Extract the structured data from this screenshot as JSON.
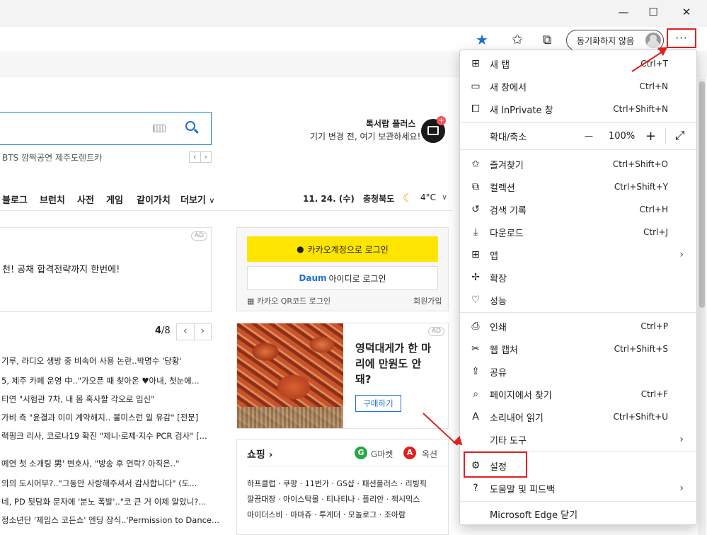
{
  "window": {
    "minimize_glyph": "—",
    "maximize_glyph": "☐",
    "close_glyph": "✕"
  },
  "toolbar": {
    "favorite_star_glyph": "★",
    "favorites_glyph": "✩",
    "collections_glyph": "⧉",
    "sync_label": "동기화하지 않음",
    "more_glyph": "···"
  },
  "page": {
    "search_links": "BTS 깜짝공연   제주도렌트카",
    "prev_arrow": "‹",
    "next_arrow": "›",
    "talk_title": "톡서랍 플러스",
    "talk_sub": "기기 변경 전, 여기 보관하세요!",
    "nav": [
      "블로그",
      "브런치",
      "사전",
      "게임",
      "같이가치",
      "더보기"
    ],
    "nav_more_chev": "∨",
    "date": "11. 24. (수)",
    "region": "충청북도",
    "weather_icon": "☾",
    "temp": "4°C",
    "weather_chev": "∨",
    "ad_label": "AD",
    "ad_text": "천! 공채 합격전략까지 한번에!",
    "pager_current": "4",
    "pager_total": "/8",
    "news": [
      "기루, 라디오 생방 중 비속어 사용 논란..박명수 '당황'",
      "5, 제주 카페 운영 中..\"가오픈 때 찾아온 ♥아내, 첫눈에...",
      "티연 \"시험관 7차, 내 몸 혹사할 각오로 임신\"",
      "가비 측 \"윤결과 이미 계약해지.. 불미스런 일 유감\" [전문]",
      "랙핑크 리사, 코로나19 확진 \"제니·로제·지수 PCR 검사\" [..."
    ],
    "news2": [
      "예연 첫 소개팅 男' 변호사, \"방송 후 연락? 아직은..\"",
      "의의 도시어부?..\"그동안 사랑해주셔서 감사합니다\" (도...",
      "네, PD 됫담화 문자에 '분노 폭발'..\"코 큰 거 이제 알았니?...",
      "정소년단 '제임스 코든쇼' 엔딩 장식..'Permission to Dance..."
    ],
    "kakao_login": "카카오계정으로 로그인",
    "daum_login": "아이디로 로그인",
    "daum_logo": "Daum",
    "qr_login": "카카오 QR코드 로그인",
    "signup": "회원가입",
    "crab_ad": "영덕대게가 한 마리에 만원도 안돼?",
    "buy": "구매하기",
    "shopping_title": "쇼핑 ›",
    "gmarket": "G마켓",
    "auction": "옥션",
    "shop_lines": [
      "하프클럽 · 쿠팡 · 11번가 · GS샵 · 패션플러스 · 리빙픽",
      "깔끔대장 · 아이스탁몰 · 티나티나 · 플리안 · 젝시믹스",
      "마이더스비 · 마마쥬 · 투게더 · 모놀로그 · 조아람"
    ]
  },
  "menu": {
    "items": [
      {
        "icon": "⊞",
        "label": "새 탭",
        "shortcut": "Ctrl+T"
      },
      {
        "icon": "▭",
        "label": "새 창에서",
        "shortcut": "Ctrl+N"
      },
      {
        "icon": "⧠",
        "label": "새 InPrivate 창",
        "shortcut": "Ctrl+Shift+N"
      },
      {
        "icon": "",
        "label": "확대/축소",
        "shortcut": ""
      },
      {
        "icon": "✩",
        "label": "즐겨찾기",
        "shortcut": "Ctrl+Shift+O"
      },
      {
        "icon": "⧉",
        "label": "컬렉션",
        "shortcut": "Ctrl+Shift+Y"
      },
      {
        "icon": "↺",
        "label": "검색 기록",
        "shortcut": "Ctrl+H"
      },
      {
        "icon": "⤓",
        "label": "다운로드",
        "shortcut": "Ctrl+J"
      },
      {
        "icon": "⊞",
        "label": "앱",
        "shortcut": ""
      },
      {
        "icon": "✢",
        "label": "확장",
        "shortcut": ""
      },
      {
        "icon": "♡",
        "label": "성능",
        "shortcut": ""
      },
      {
        "icon": "⎙",
        "label": "인쇄",
        "shortcut": "Ctrl+P"
      },
      {
        "icon": "✂",
        "label": "웹 캡처",
        "shortcut": "Ctrl+Shift+S"
      },
      {
        "icon": "⇪",
        "label": "공유",
        "shortcut": ""
      },
      {
        "icon": "⌕",
        "label": "페이지에서 찾기",
        "shortcut": "Ctrl+F"
      },
      {
        "icon": "A",
        "label": "소리내어 읽기",
        "shortcut": "Ctrl+Shift+U"
      },
      {
        "icon": "",
        "label": "기타 도구",
        "shortcut": ""
      },
      {
        "icon": "⚙",
        "label": "설정",
        "shortcut": ""
      },
      {
        "icon": "?",
        "label": "도움말 및 피드백",
        "shortcut": ""
      },
      {
        "icon": "",
        "label": "Microsoft Edge 닫기",
        "shortcut": ""
      }
    ],
    "zoom_minus": "—",
    "zoom_value": "100%",
    "zoom_plus": "+",
    "fullscreen": "⤢",
    "submenu_chev": "›"
  },
  "colors": {
    "annotation_red": "#e02020",
    "accent_blue": "#1e6fd0",
    "kakao_yellow": "#fee500"
  }
}
